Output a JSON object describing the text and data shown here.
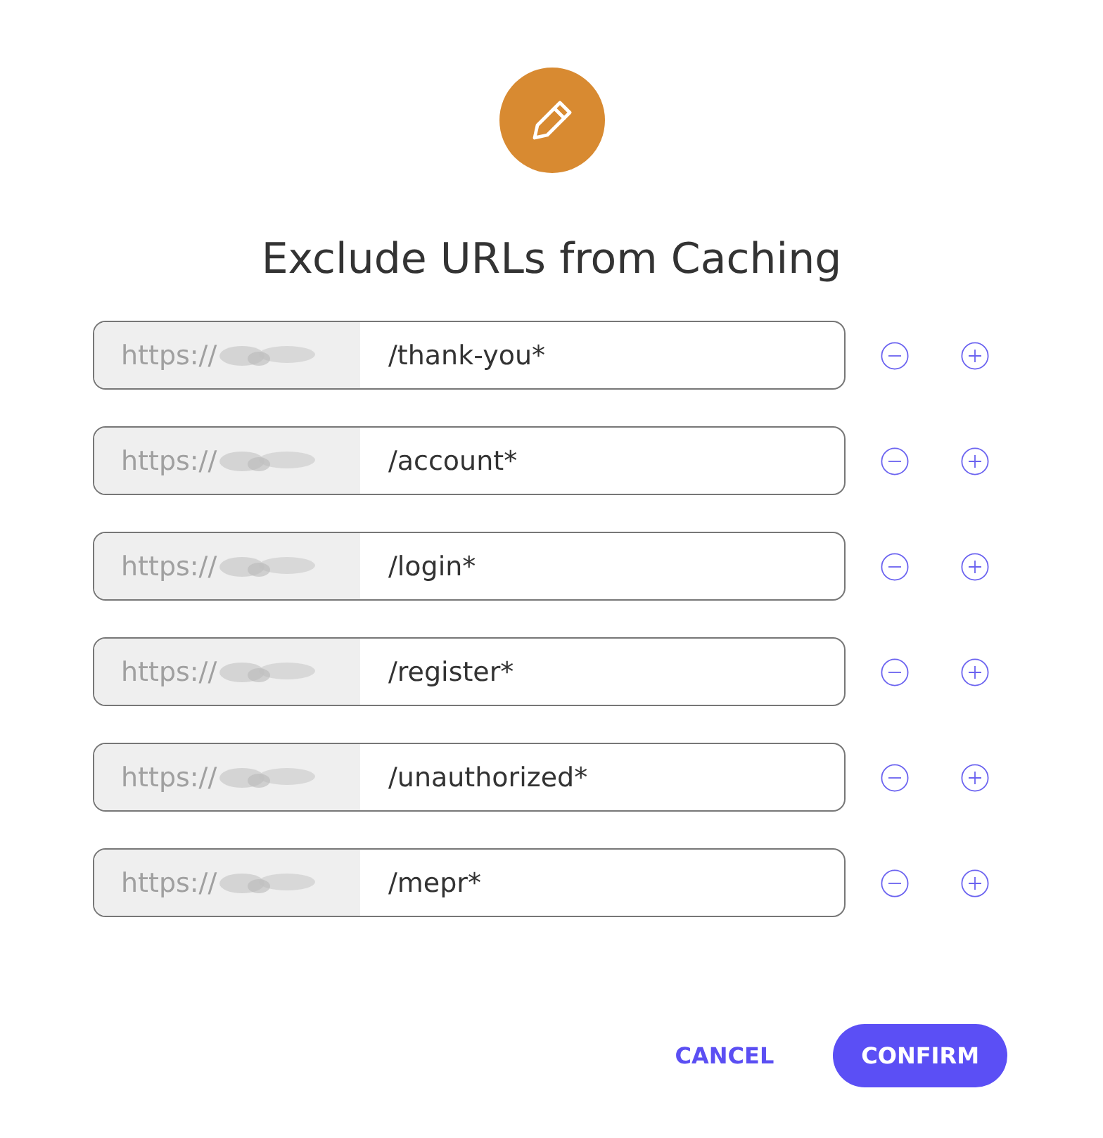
{
  "dialog": {
    "title": "Exclude URLs from Caching"
  },
  "rows": [
    {
      "prefix": "https://",
      "path": "/thank-you*"
    },
    {
      "prefix": "https://",
      "path": "/account*"
    },
    {
      "prefix": "https://",
      "path": "/login*"
    },
    {
      "prefix": "https://",
      "path": "/register*"
    },
    {
      "prefix": "https://",
      "path": "/unauthorized*"
    },
    {
      "prefix": "https://",
      "path": "/mepr*"
    }
  ],
  "buttons": [
    {
      "label": "CANCEL",
      "kind": "text"
    },
    {
      "label": "CONFIRM",
      "kind": "primary"
    }
  ]
}
